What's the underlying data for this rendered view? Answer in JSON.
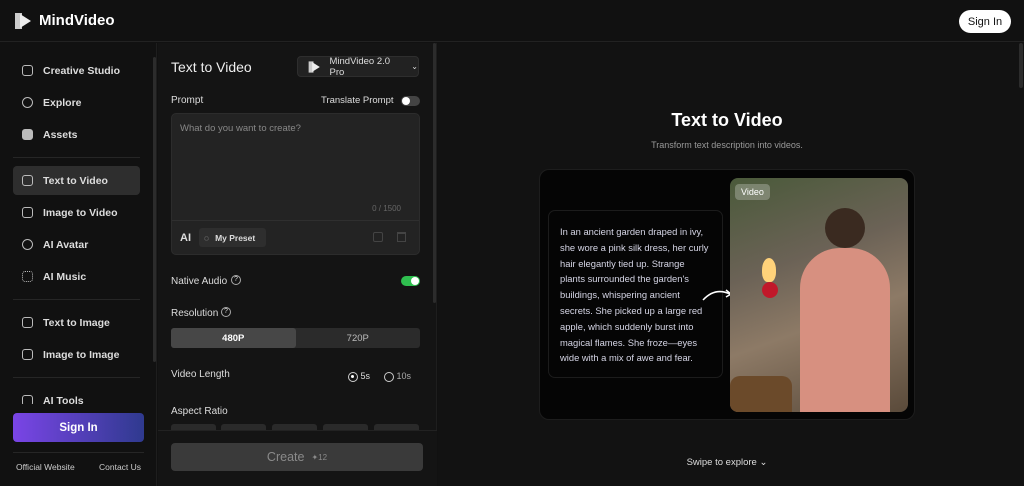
{
  "header": {
    "brand": "MindVideo",
    "signin": "Sign In"
  },
  "sidebar": {
    "items": [
      {
        "label": "Creative Studio",
        "icon": "studio-icon"
      },
      {
        "label": "Explore",
        "icon": "planet-icon"
      },
      {
        "label": "Assets",
        "icon": "folder-icon"
      },
      {
        "label": "Text to Video",
        "icon": "text-video-icon",
        "active": true
      },
      {
        "label": "Image to Video",
        "icon": "image-video-icon"
      },
      {
        "label": "AI Avatar",
        "icon": "avatar-icon"
      },
      {
        "label": "AI Music",
        "icon": "music-icon"
      },
      {
        "label": "Text to Image",
        "icon": "text-image-icon"
      },
      {
        "label": "Image to Image",
        "icon": "image-image-icon"
      },
      {
        "label": "AI Tools",
        "icon": "tools-icon"
      }
    ],
    "signin": "Sign In",
    "official": "Official Website",
    "contact": "Contact Us"
  },
  "panel": {
    "title": "Text to Video",
    "model": "MindVideo 2.0 Pro",
    "prompt_label": "Prompt",
    "translate": "Translate Prompt",
    "placeholder": "What do you want to create?",
    "counter": "0 / 1500",
    "ai": "AI",
    "preset": "My Preset",
    "native_audio": "Native Audio",
    "native_audio_on": true,
    "resolution": "Resolution",
    "res_options": [
      "480P",
      "720P"
    ],
    "video_length": "Video Length",
    "len_options": [
      "5s",
      "10s"
    ],
    "aspect": "Aspect Ratio",
    "create": "Create",
    "cost": "12",
    "accent": "#2fbf4f"
  },
  "main": {
    "title": "Text to Video",
    "subtitle": "Transform text description into videos.",
    "story": "In an ancient garden draped in ivy, she wore a pink silk dress, her curly hair elegantly tied up. Strange plants surrounded the garden's buildings, whispering ancient secrets. She picked up a large red apple, which suddenly burst into magical flames. She froze—eyes wide with a mix of awe and fear.",
    "badge": "Video",
    "swipe": "Swipe to explore"
  }
}
